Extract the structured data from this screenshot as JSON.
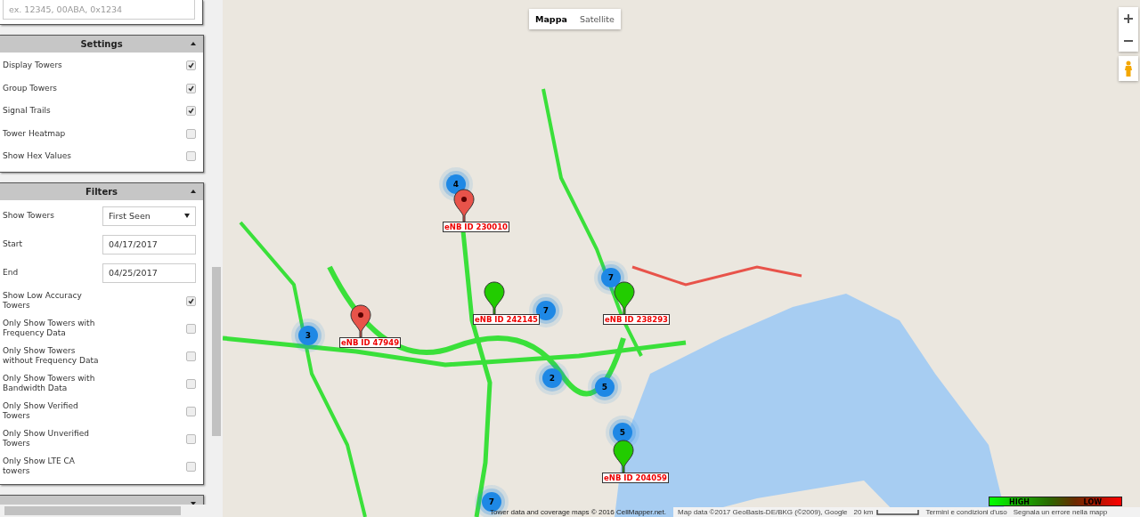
{
  "search": {
    "placeholder": "ex. 12345, 00ABA, 0x1234"
  },
  "settings": {
    "title": "Settings",
    "expanded": true,
    "options": [
      {
        "label": "Display Towers",
        "checked": true
      },
      {
        "label": "Group Towers",
        "checked": true
      },
      {
        "label": "Signal Trails",
        "checked": true
      },
      {
        "label": "Tower Heatmap",
        "checked": false
      },
      {
        "label": "Show Hex Values",
        "checked": false
      }
    ]
  },
  "filters": {
    "title": "Filters",
    "expanded": true,
    "fields": [
      {
        "kind": "select",
        "label": "Show Towers",
        "value": "First Seen"
      },
      {
        "kind": "text",
        "label": "Start",
        "value": "04/17/2017"
      },
      {
        "kind": "text",
        "label": "End",
        "value": "04/25/2017"
      },
      {
        "kind": "checkbox",
        "label": "Show Low Accuracy Towers",
        "checked": true
      },
      {
        "kind": "checkbox",
        "label": "Only Show Towers with Frequency Data",
        "checked": false
      },
      {
        "kind": "checkbox",
        "label": "Only Show Towers without Frequency Data",
        "checked": false
      },
      {
        "kind": "checkbox",
        "label": "Only Show Towers with Bandwidth Data",
        "checked": false
      },
      {
        "kind": "checkbox",
        "label": "Only Show Verified Towers",
        "checked": false
      },
      {
        "kind": "checkbox",
        "label": "Only Show Unverified Towers",
        "checked": false
      },
      {
        "kind": "checkbox",
        "label": "Only Show LTE CA towers",
        "checked": false
      }
    ]
  },
  "next_panel": {
    "expanded": false
  },
  "map": {
    "map_types": [
      {
        "label": "Mappa",
        "selected": true
      },
      {
        "label": "Satellite",
        "selected": false
      }
    ],
    "clusters": [
      {
        "count": "4"
      },
      {
        "count": "7"
      },
      {
        "count": "3"
      },
      {
        "count": "7"
      },
      {
        "count": "2"
      },
      {
        "count": "5"
      },
      {
        "count": "5"
      },
      {
        "count": "7"
      }
    ],
    "towers": [
      {
        "label": "eNB ID 230010",
        "color": "#e8534a"
      },
      {
        "label": "eNB ID 47949",
        "color": "#e8534a"
      },
      {
        "label": "eNB ID 242145",
        "color": "#22cc00"
      },
      {
        "label": "eNB ID 238293",
        "color": "#22cc00"
      },
      {
        "label": "eNB ID 204059",
        "color": "#22cc00"
      }
    ],
    "legend": {
      "high": "HIGH",
      "low": "LOW"
    },
    "credit": "Tower data and coverage maps © 2016 CellMapper.net.",
    "map_data": "Map data ©2017 GeoBasis-DE/BKG (©2009), Google",
    "scale": "20 km",
    "links": [
      "Termini e condizioni d'uso",
      "Segnala un errore nella mapp"
    ]
  }
}
